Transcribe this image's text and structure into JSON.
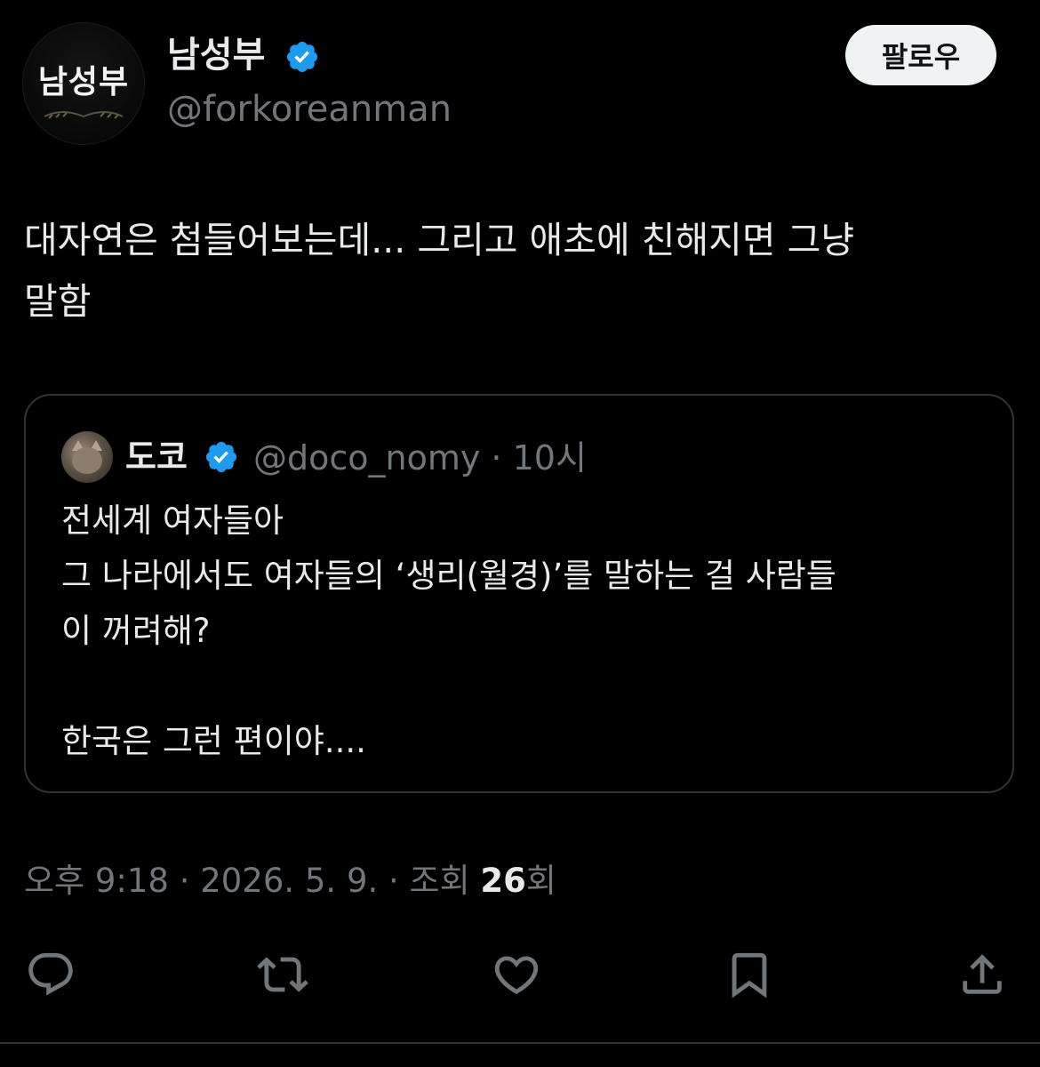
{
  "author": {
    "avatar_text": "남성부",
    "display_name": "남성부",
    "handle": "@forkoreanman",
    "verified": true
  },
  "follow_button_label": "팔로우",
  "tweet": {
    "text": "대자연은 첨들어보는데... 그리고 애초에 친해지면 그냥\n말함"
  },
  "quote": {
    "display_name": "도코",
    "handle_time": "@doco_nomy · 10시",
    "verified": true,
    "text": "전세계 여자들아\n그 나라에서도 여자들의 ‘생리(월경)’를 말하는 걸 사람들\n이 꺼려해?\n\n한국은 그런 편이야...."
  },
  "meta": {
    "time_date_prefix": "오후 9:18 · 2026. 5. 9. · 조회 ",
    "views_count": "26",
    "views_suffix": "회"
  },
  "actions": [
    {
      "name": "reply-icon"
    },
    {
      "name": "retweet-icon"
    },
    {
      "name": "like-icon"
    },
    {
      "name": "bookmark-icon"
    },
    {
      "name": "share-icon"
    }
  ],
  "colors": {
    "background": "#000000",
    "text_primary": "#e7e9ea",
    "text_secondary": "#71767b",
    "verified_blue": "#1d9bf0",
    "border": "#2f3336",
    "follow_bg": "#eff3f4"
  }
}
